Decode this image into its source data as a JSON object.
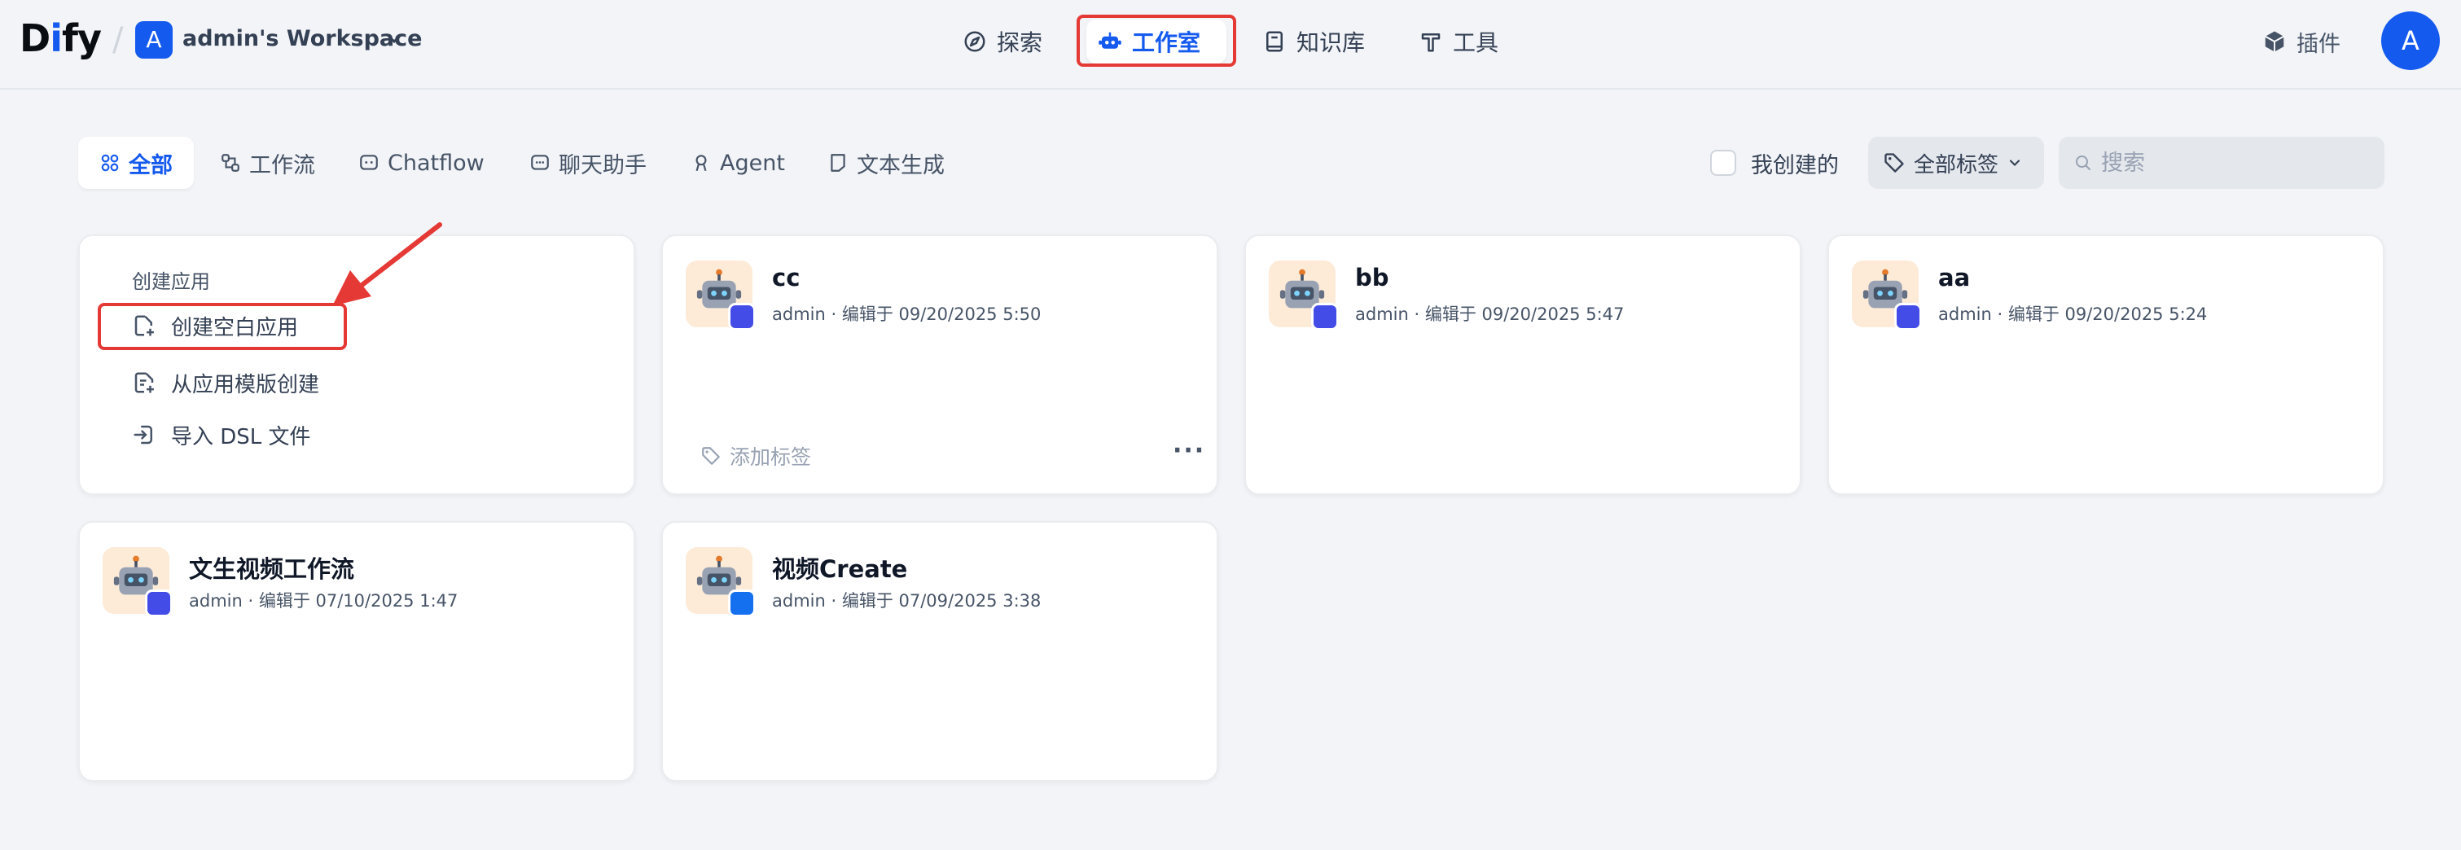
{
  "header": {
    "logo_a": "D",
    "logo_b": "i",
    "logo_c": "fy",
    "separator": "/",
    "workspace_initial": "A",
    "workspace_name": "admin's Workspace",
    "nav": {
      "explore": "探索",
      "studio": "工作室",
      "datasets": "知识库",
      "tools": "工具"
    },
    "plugins": "插件",
    "user_initial": "A"
  },
  "filters": {
    "tabs": [
      "全部",
      "工作流",
      "Chatflow",
      "聊天助手",
      "Agent",
      "文本生成"
    ],
    "active_tab": "全部",
    "mine_label": "我创建的",
    "tag_filter": "全部标签",
    "search_placeholder": "搜索"
  },
  "create": {
    "heading": "创建应用",
    "blank": "创建空白应用",
    "template": "从应用模版创建",
    "dsl": "导入 DSL 文件"
  },
  "apps": [
    {
      "name": "cc",
      "meta": "admin · 编辑于 09/20/2025 5:50",
      "mode": "workflow",
      "tag_label": "添加标签",
      "more": "···"
    },
    {
      "name": "bb",
      "meta": "admin · 编辑于 09/20/2025 5:47",
      "mode": "workflow"
    },
    {
      "name": "aa",
      "meta": "admin · 编辑于 09/20/2025 5:24",
      "mode": "workflow"
    },
    {
      "name": "文生视频工作流",
      "meta": "admin · 编辑于 07/10/2025 1:47",
      "mode": "workflow"
    },
    {
      "name": "视频Create",
      "meta": "admin · 编辑于 07/09/2025 3:38",
      "mode": "chat"
    }
  ],
  "colors": {
    "accent": "#155aef",
    "highlight_box": "#e53935",
    "workflow_badge": "#444ce7",
    "chat_badge": "#1570ef",
    "app_icon_bg": "#fdebd8"
  }
}
